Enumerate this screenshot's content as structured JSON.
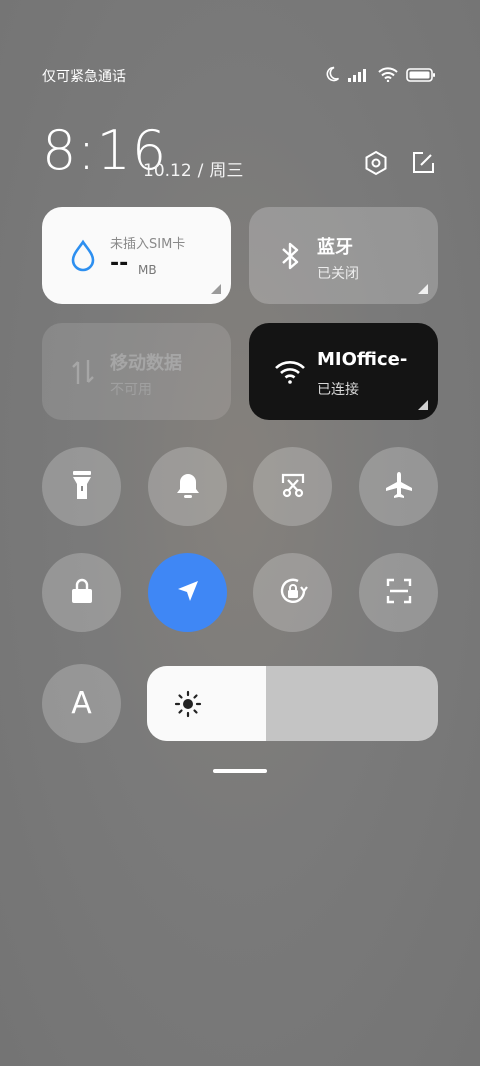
{
  "status_bar": {
    "carrier_text": "仅可紧急通话",
    "icons": [
      "moon-icon",
      "signal-icon",
      "wifi-icon",
      "battery-icon"
    ]
  },
  "header": {
    "time": "8:16",
    "date": "10.12",
    "separator": "/",
    "weekday": "周三",
    "actions": [
      "settings-icon",
      "edit-icon"
    ]
  },
  "tiles": {
    "sim": {
      "title": "未插入SIM卡",
      "value": "--",
      "unit": "MB",
      "icon": "water-drop-icon",
      "accent": "#2d8ff0"
    },
    "bluetooth": {
      "title": "蓝牙",
      "status": "已关闭",
      "icon": "bluetooth-icon"
    },
    "mobile_data": {
      "title": "移动数据",
      "status": "不可用",
      "icon": "data-arrows-icon"
    },
    "wifi": {
      "title": "MIOffice-",
      "status": "已连接",
      "icon": "wifi-icon"
    }
  },
  "toggles_row1": [
    "flashlight-icon",
    "bell-icon",
    "screenshot-icon",
    "airplane-icon"
  ],
  "toggles_row2": [
    "lock-icon",
    "location-icon",
    "rotation-lock-icon",
    "scan-icon"
  ],
  "font_button": {
    "label": "A"
  },
  "brightness": {
    "level": 0.41,
    "icon": "sun-icon"
  },
  "colors": {
    "active_blue": "#3f87f5",
    "wifi_tile": "#141414",
    "light_tile": "#fafafa"
  }
}
